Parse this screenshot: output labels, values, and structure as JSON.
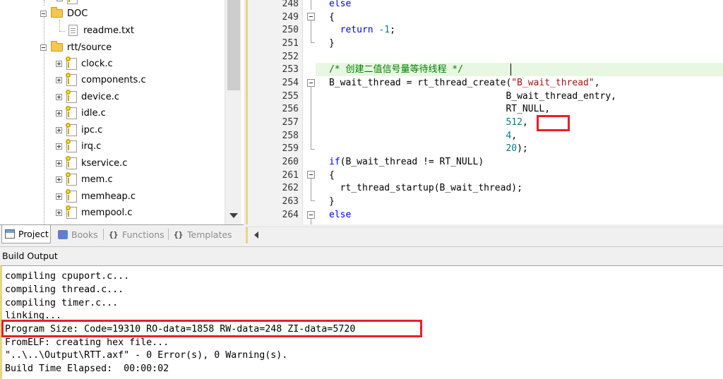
{
  "project_tree": {
    "items": [
      {
        "label": "DOC",
        "type": "folder"
      },
      {
        "label": "readme.txt",
        "type": "txt"
      },
      {
        "label": "rtt/source",
        "type": "folder"
      },
      {
        "label": "clock.c",
        "type": "c"
      },
      {
        "label": "components.c",
        "type": "c"
      },
      {
        "label": "device.c",
        "type": "c"
      },
      {
        "label": "idle.c",
        "type": "c"
      },
      {
        "label": "ipc.c",
        "type": "c"
      },
      {
        "label": "irq.c",
        "type": "c"
      },
      {
        "label": "kservice.c",
        "type": "c"
      },
      {
        "label": "mem.c",
        "type": "c"
      },
      {
        "label": "memheap.c",
        "type": "c"
      },
      {
        "label": "mempool.c",
        "type": "c"
      }
    ]
  },
  "tabs": [
    {
      "label": "Project",
      "active": true,
      "icon": "project-icon"
    },
    {
      "label": "Books",
      "active": false,
      "icon": "books-icon"
    },
    {
      "label": "Functions",
      "active": false,
      "icon": "functions-icon",
      "glyph": "{}"
    },
    {
      "label": "Templates",
      "active": false,
      "icon": "templates-icon",
      "glyph": "{}"
    }
  ],
  "editor": {
    "lines": [
      {
        "n": "248",
        "code": "else"
      },
      {
        "n": "249",
        "code": "{"
      },
      {
        "n": "250",
        "code": "  return -1;"
      },
      {
        "n": "251",
        "code": "}"
      },
      {
        "n": "252",
        "code": ""
      },
      {
        "n": "253",
        "code": "/* 创建二值信号量等待线程 */"
      },
      {
        "n": "254",
        "code": "B_wait_thread = rt_thread_create(\"B_wait_thread\","
      },
      {
        "n": "255",
        "code": "                                B_wait_thread_entry,"
      },
      {
        "n": "256",
        "code": "                                RT_NULL,"
      },
      {
        "n": "257",
        "code": "                                512,"
      },
      {
        "n": "258",
        "code": "                                4,"
      },
      {
        "n": "259",
        "code": "                                20);"
      },
      {
        "n": "260",
        "code": "if(B_wait_thread != RT_NULL)"
      },
      {
        "n": "261",
        "code": "{"
      },
      {
        "n": "262",
        "code": "  rt_thread_startup(B_wait_thread);"
      },
      {
        "n": "263",
        "code": "}"
      },
      {
        "n": "264",
        "code": "else"
      }
    ]
  },
  "build_output": {
    "title": "Build Output",
    "lines": [
      "compiling cpuport.c...",
      "compiling thread.c...",
      "compiling timer.c...",
      "linking...",
      "Program Size: Code=19310 RO-data=1858 RW-data=248 ZI-data=5720",
      "FromELF: creating hex file...",
      "\"..\\..\\Output\\RTT.axf\" - 0 Error(s), 0 Warning(s).",
      "Build Time Elapsed:  00:00:02"
    ]
  },
  "colors": {
    "keyword": "#0000ff",
    "number": "#008080",
    "string": "#a31515",
    "comment": "#008000",
    "highlight_box": "#e8202a"
  }
}
